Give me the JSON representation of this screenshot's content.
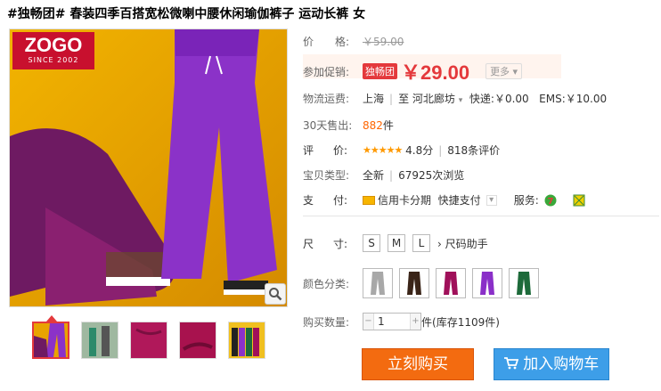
{
  "product": {
    "title": "#独畅团# 春装四季百搭宽松微喇中腰休闲瑜伽裤子 运动长裤 女"
  },
  "brand": {
    "logo": "ZOGO",
    "since": "SINCE 2002"
  },
  "price": {
    "label": "价　　格:",
    "original": "￥59.00"
  },
  "promo": {
    "label": "参加促销:",
    "tag": "独畅团",
    "price": "￥29.00",
    "more": "更多"
  },
  "shipping": {
    "label": "物流运费:",
    "from": "上海",
    "to_prefix": "至",
    "to": "河北廊坊",
    "express": "快递:￥0.00",
    "ems": "EMS:￥10.00"
  },
  "sales": {
    "label": "30天售出:",
    "count": "882",
    "unit": "件"
  },
  "rating": {
    "label1": "评",
    "label2": "价:",
    "stars": "★★★★★",
    "score": "4.8分",
    "reviews": "818条评价"
  },
  "item_type": {
    "label": "宝贝类型:",
    "value": "全新",
    "views": "67925次浏览"
  },
  "payment": {
    "label1": "支",
    "label2": "付:",
    "card": "信用卡分期",
    "quick": "快捷支付",
    "services_label": "服务:"
  },
  "size": {
    "label1": "尺",
    "label2": "寸:",
    "options": [
      "S",
      "M",
      "L"
    ],
    "helper": "尺码助手"
  },
  "color": {
    "label": "颜色分类:",
    "options": [
      {
        "name": "grey",
        "color": "#a8a8a8"
      },
      {
        "name": "coffee",
        "color": "#3a2418"
      },
      {
        "name": "rose-red",
        "color": "#a0105a"
      },
      {
        "name": "purple",
        "color": "#8a2fc8"
      },
      {
        "name": "green",
        "color": "#1d6a3a"
      }
    ]
  },
  "quantity": {
    "label": "购买数量:",
    "value": "1",
    "unit": "件",
    "stock": "(库存1109件)"
  },
  "actions": {
    "buy": "立刻购买",
    "cart": "加入购物车"
  },
  "colors": {
    "accent": "#e4393c",
    "buy": "#f36b10",
    "cart": "#3d9ee8",
    "main_image_bg": "#e8a400"
  }
}
